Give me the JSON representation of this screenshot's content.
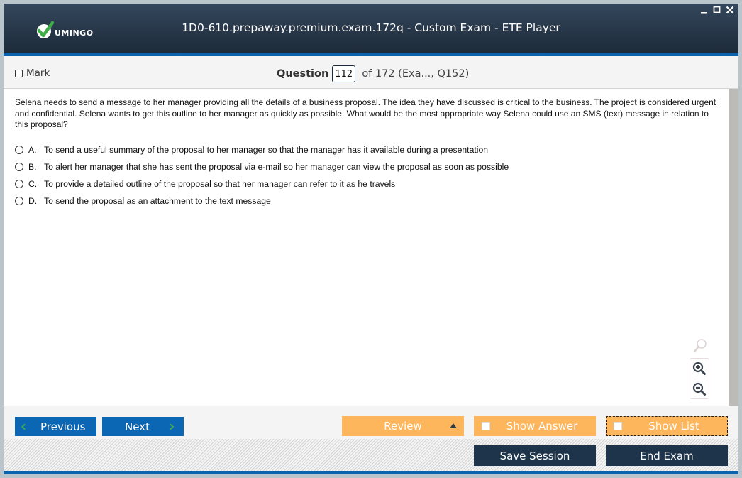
{
  "app": {
    "logo_text": "UMINGO",
    "window_title": "1D0-610.prepaway.premium.exam.172q - Custom Exam - ETE Player",
    "colors": {
      "titlebar": "#1d2b3a",
      "accent_blue": "#0b62ad",
      "nav_button": "#0b66b4",
      "orange_button": "#fdb65b",
      "dark_button": "#1d344b",
      "logo_green": "#3fae49"
    }
  },
  "window_controls": {
    "minimize": "minimize-icon",
    "maximize": "maximize-icon",
    "close": "close-icon"
  },
  "header": {
    "mark_label": "Mark",
    "question_label": "Question",
    "question_number": "112",
    "question_of": "of 172 (Exa..., Q152)"
  },
  "question": {
    "text": "Selena needs to send a message to her manager providing all the details of a business proposal. The idea they have discussed is critical to the business. The project is considered urgent and confidential. Selena wants to get this outline to her manager as quickly as possible. What would be the most appropriate way Selena could use an SMS (text) message in relation to this proposal?",
    "options": [
      {
        "letter": "A.",
        "text": "To send a useful summary of the proposal to her manager so that the manager has it available during a presentation"
      },
      {
        "letter": "B.",
        "text": "To alert her manager that she has sent the proposal via e-mail so her manager can view the proposal as soon as possible"
      },
      {
        "letter": "C.",
        "text": "To provide a detailed outline of the proposal so that her manager can refer to it as he travels"
      },
      {
        "letter": "D.",
        "text": "To send the proposal as an attachment to the text message"
      }
    ]
  },
  "zoom_tools": {
    "search": "search-icon",
    "zoom_in": "zoom-in-icon",
    "zoom_out": "zoom-out-icon"
  },
  "navigation": {
    "previous_label": "Previous",
    "next_label": "Next",
    "review_label": "Review",
    "show_answer_label": "Show Answer",
    "show_list_label": "Show List"
  },
  "footer": {
    "save_session_label": "Save Session",
    "end_exam_label": "End Exam"
  }
}
